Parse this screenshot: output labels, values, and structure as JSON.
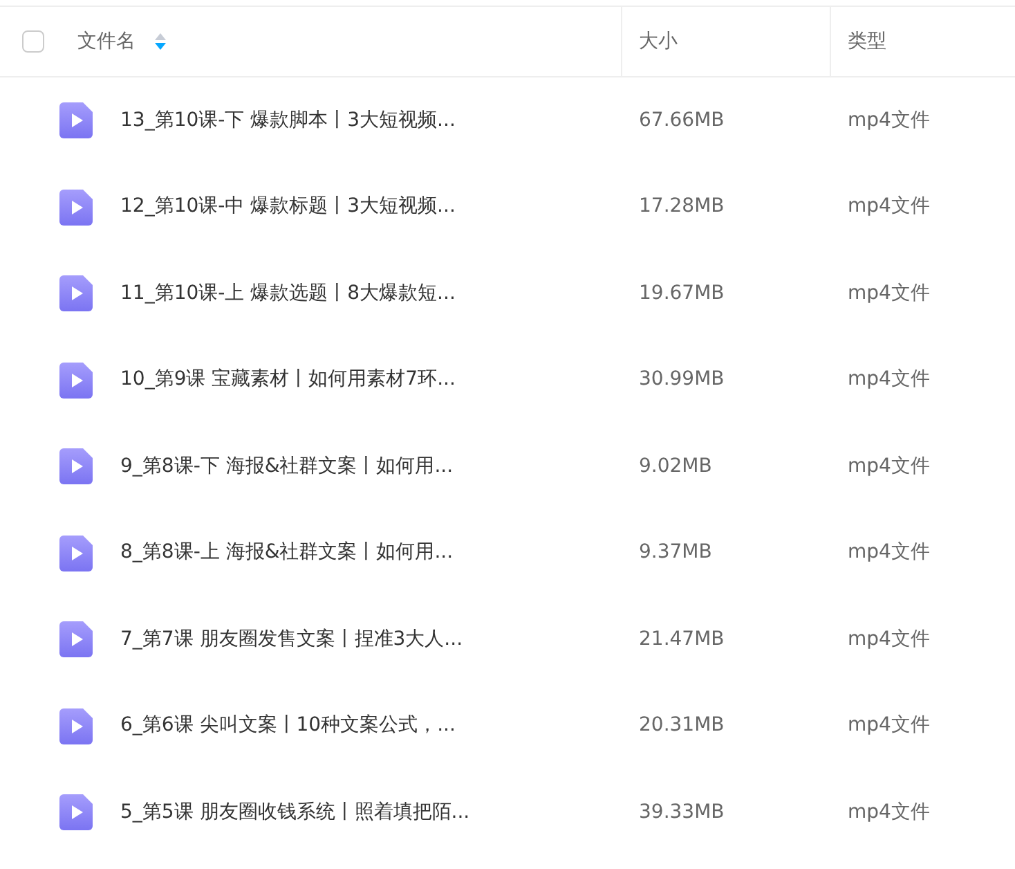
{
  "table": {
    "select_all": {
      "checked": false
    },
    "columns": [
      {
        "label": "文件名",
        "sort_descending": true
      },
      {
        "label": "大小"
      },
      {
        "label": "类型"
      }
    ],
    "rows": [
      {
        "name": "13_第10课-下 爆款脚本丨3大短视频...",
        "size": "67.66MB",
        "type": "mp4文件"
      },
      {
        "name": "12_第10课-中 爆款标题丨3大短视频...",
        "size": "17.28MB",
        "type": "mp4文件"
      },
      {
        "name": "11_第10课-上 爆款选题丨8大爆款短...",
        "size": "19.67MB",
        "type": "mp4文件"
      },
      {
        "name": "10_第9课 宝藏素材丨如何用素材7环...",
        "size": "30.99MB",
        "type": "mp4文件"
      },
      {
        "name": "9_第8课-下 海报&社群文案丨如何用...",
        "size": "9.02MB",
        "type": "mp4文件"
      },
      {
        "name": "8_第8课-上 海报&社群文案丨如何用...",
        "size": "9.37MB",
        "type": "mp4文件"
      },
      {
        "name": "7_第7课 朋友圈发售文案丨捏准3大人...",
        "size": "21.47MB",
        "type": "mp4文件"
      },
      {
        "name": "6_第6课 尖叫文案丨10种文案公式，...",
        "size": "20.31MB",
        "type": "mp4文件"
      },
      {
        "name": "5_第5课 朋友圈收钱系统丨照着填把陌...",
        "size": "39.33MB",
        "type": "mp4文件"
      }
    ]
  }
}
